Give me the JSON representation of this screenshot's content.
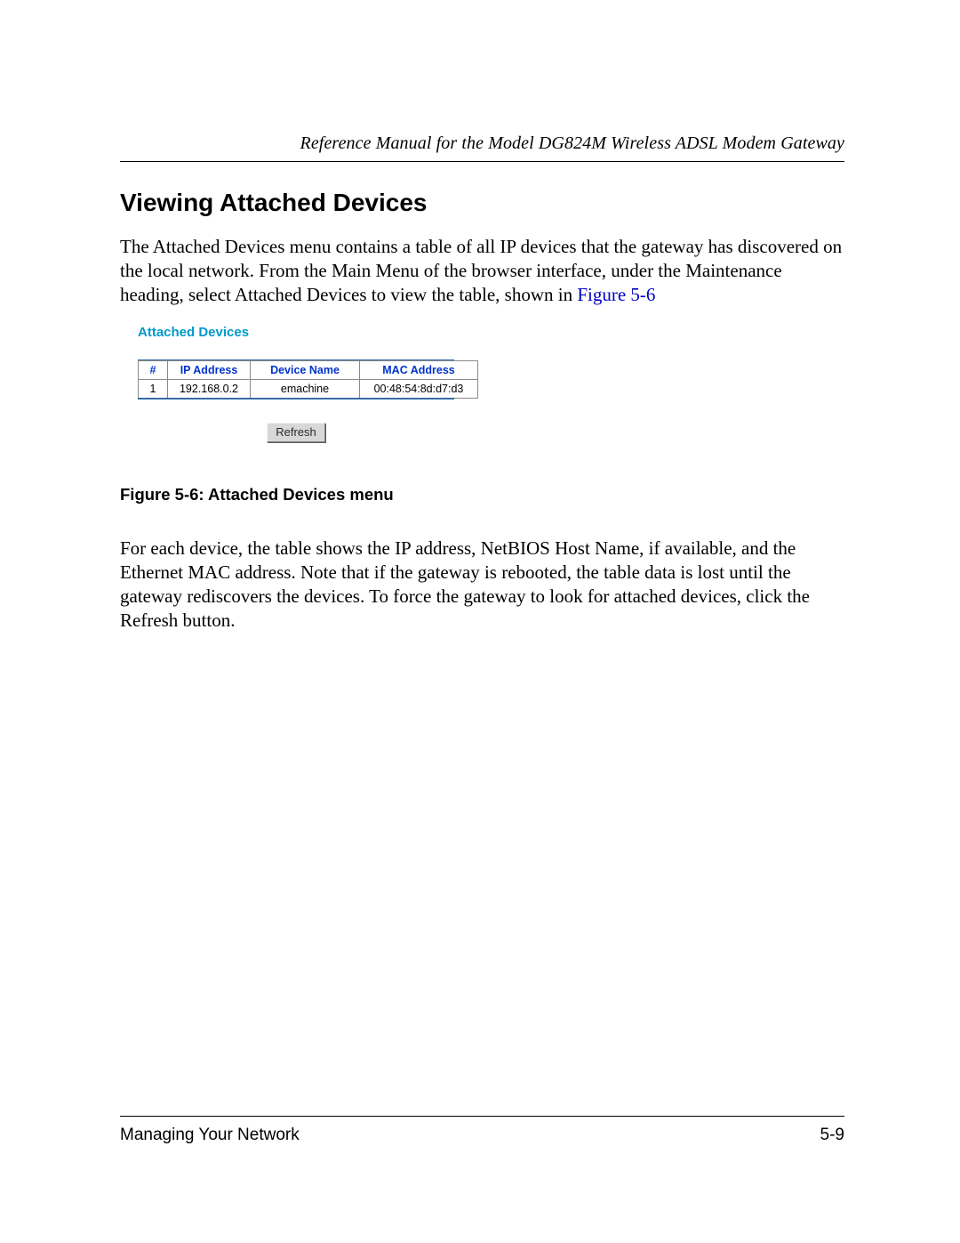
{
  "header": {
    "running_head": "Reference Manual for the Model DG824M Wireless ADSL Modem Gateway"
  },
  "section": {
    "title": "Viewing Attached Devices",
    "para1_pre": "The Attached Devices menu contains a table of all IP devices that the gateway has discovered on the local network. From the Main Menu of the browser interface, under the Maintenance heading, select Attached Devices to view the table, shown in ",
    "para1_link": "Figure 5-6",
    "caption": "Figure 5-6: Attached Devices menu",
    "para2": "For each device, the table shows the IP address, NetBIOS Host Name, if available, and the Ethernet MAC address. Note that if the gateway is rebooted, the table data is lost until the gateway rediscovers the devices. To force the gateway to look for attached devices, click the Refresh button."
  },
  "figure": {
    "panel_title": "Attached Devices",
    "columns": {
      "num": "#",
      "ip": "IP Address",
      "name": "Device Name",
      "mac": "MAC Address"
    },
    "row": {
      "num": "1",
      "ip": "192.168.0.2",
      "name": "emachine",
      "mac": "00:48:54:8d:d7:d3"
    },
    "refresh_label": "Refresh"
  },
  "footer": {
    "left": "Managing Your Network",
    "right": "5-9"
  }
}
